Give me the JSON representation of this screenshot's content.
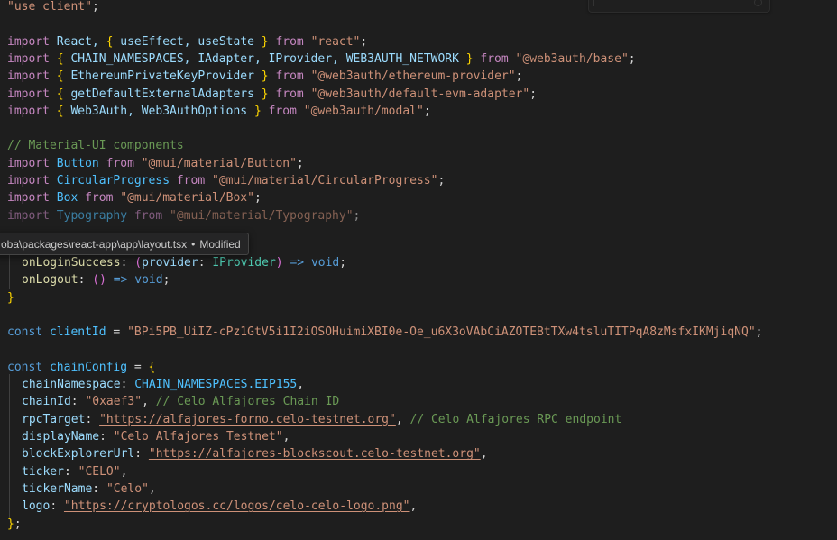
{
  "editor": {
    "language": "typescript",
    "theme": "dark-plus",
    "background_color": "#1e1e1e",
    "colors": {
      "keyword": "#c586c0",
      "keyword_control": "#569cd6",
      "identifier": "#9cdcfe",
      "variable": "#4fc1ff",
      "string": "#ce9178",
      "comment": "#6a9955",
      "property": "#dcdcaa",
      "type": "#4ec9b0",
      "punctuation": "#d4d4d4",
      "brace_level1": "#ffd700",
      "brace_level2": "#da70d6",
      "indent_guide": "#404040"
    }
  },
  "tooltip": {
    "path": "oba\\packages\\react-app\\app\\layout.tsx",
    "separator": "•",
    "status": "Modified"
  },
  "code": {
    "directive": {
      "quote_open": "\"",
      "text": "use client",
      "quote_close": "\"",
      "semicolon": ";"
    },
    "imports_core": [
      {
        "keyword": "import",
        "binding": "React, ",
        "brace_open": "{",
        "named": " useEffect, useState ",
        "brace_close": "}",
        "from": "from",
        "module": "\"react\"",
        "semicolon": ";"
      },
      {
        "keyword": "import",
        "binding": "",
        "brace_open": "{",
        "named": " CHAIN_NAMESPACES, IAdapter, IProvider, WEB3AUTH_NETWORK ",
        "brace_close": "}",
        "from": "from",
        "module": "\"@web3auth/base\"",
        "semicolon": ";"
      },
      {
        "keyword": "import",
        "binding": "",
        "brace_open": "{",
        "named": " EthereumPrivateKeyProvider ",
        "brace_close": "}",
        "from": "from",
        "module": "\"@web3auth/ethereum-provider\"",
        "semicolon": ";"
      },
      {
        "keyword": "import",
        "binding": "",
        "brace_open": "{",
        "named": " getDefaultExternalAdapters ",
        "brace_close": "}",
        "from": "from",
        "module": "\"@web3auth/default-evm-adapter\"",
        "semicolon": ";"
      },
      {
        "keyword": "import",
        "binding": "",
        "brace_open": "{",
        "named": " Web3Auth, Web3AuthOptions ",
        "brace_close": "}",
        "from": "from",
        "module": "\"@web3auth/modal\"",
        "semicolon": ";"
      }
    ],
    "mui_comment": "// Material-UI components",
    "imports_mui": [
      {
        "keyword": "import",
        "default_binding": "Button",
        "from": "from",
        "module": "\"@mui/material/Button\"",
        "semicolon": ";"
      },
      {
        "keyword": "import",
        "default_binding": "CircularProgress",
        "from": "from",
        "module": "\"@mui/material/CircularProgress\"",
        "semicolon": ";"
      },
      {
        "keyword": "import",
        "default_binding": "Box",
        "from": "from",
        "module": "\"@mui/material/Box\"",
        "semicolon": ";"
      },
      {
        "keyword": "import",
        "default_binding": "Typography",
        "from": "from",
        "module": "\"@mui/material/Typography\"",
        "semicolon": ";"
      }
    ],
    "interface_tail": {
      "member_login": {
        "name": "onLoginSuccess",
        "colon": ":",
        "paren_open": "(",
        "param_name": "provider",
        "param_colon": ":",
        "param_type": "IProvider",
        "paren_close": ")",
        "arrow": "=>",
        "return_type": "void",
        "semicolon": ";"
      },
      "member_logout": {
        "name": "onLogout",
        "colon": ":",
        "paren_open": "(",
        "paren_close": ")",
        "arrow": "=>",
        "return_type": "void",
        "semicolon": ";"
      },
      "closing_brace": "}"
    },
    "client_id": {
      "keyword": "const",
      "name": "clientId",
      "equals": "=",
      "value": "\"BPi5PB_UiIZ-cPz1GtV5i1I2iOSOHuimiXBI0e-Oe_u6X3oVAbCiAZOTEBtTXw4tsluTITPqA8zMsfxIKMjiqNQ\"",
      "semicolon": ";"
    },
    "chain_config": {
      "keyword": "const",
      "name": "chainConfig",
      "equals": "=",
      "brace_open": "{",
      "brace_close": "}",
      "semicolon": ";",
      "entries": [
        {
          "key": "chainNamespace",
          "colon": ":",
          "value": "CHAIN_NAMESPACES.EIP155",
          "value_kind": "identifier",
          "comma": ",",
          "comment": ""
        },
        {
          "key": "chainId",
          "colon": ":",
          "value": "\"0xaef3\"",
          "value_kind": "string",
          "comma": ",",
          "comment": "// Celo Alfajores Chain ID"
        },
        {
          "key": "rpcTarget",
          "colon": ":",
          "value": "\"https://alfajores-forno.celo-testnet.org\"",
          "value_kind": "link",
          "comma": ",",
          "comment": "// Celo Alfajores RPC endpoint"
        },
        {
          "key": "displayName",
          "colon": ":",
          "value": "\"Celo Alfajores Testnet\"",
          "value_kind": "string",
          "comma": ",",
          "comment": ""
        },
        {
          "key": "blockExplorerUrl",
          "colon": ":",
          "value": "\"https://alfajores-blockscout.celo-testnet.org\"",
          "value_kind": "link",
          "comma": ",",
          "comment": ""
        },
        {
          "key": "ticker",
          "colon": ":",
          "value": "\"CELO\"",
          "value_kind": "string",
          "comma": ",",
          "comment": ""
        },
        {
          "key": "tickerName",
          "colon": ":",
          "value": "\"Celo\"",
          "value_kind": "string",
          "comma": ",",
          "comment": ""
        },
        {
          "key": "logo",
          "colon": ":",
          "value": "\"https://cryptologos.cc/logos/celo-celo-logo.png\"",
          "value_kind": "link",
          "comma": ",",
          "comment": ""
        }
      ]
    }
  }
}
